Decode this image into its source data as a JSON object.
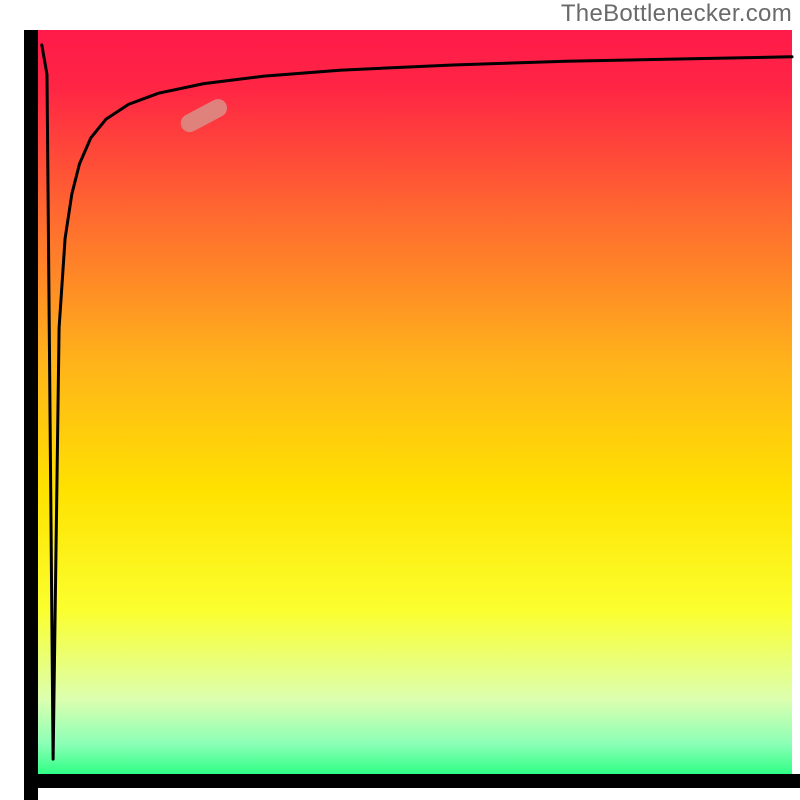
{
  "watermark": "TheBottlenecker.com",
  "chart_data": {
    "type": "line",
    "title": "",
    "xlabel": "",
    "ylabel": "",
    "xlim": [
      0,
      100
    ],
    "ylim": [
      0,
      100
    ],
    "background_gradient": {
      "stops": [
        {
          "offset": 0.0,
          "color": "#ff1a4a"
        },
        {
          "offset": 0.08,
          "color": "#ff2644"
        },
        {
          "offset": 0.25,
          "color": "#ff6a2f"
        },
        {
          "offset": 0.45,
          "color": "#ffb41a"
        },
        {
          "offset": 0.62,
          "color": "#ffe200"
        },
        {
          "offset": 0.78,
          "color": "#fbff2e"
        },
        {
          "offset": 0.9,
          "color": "#dcffb0"
        },
        {
          "offset": 0.96,
          "color": "#8affb6"
        },
        {
          "offset": 1.0,
          "color": "#2fff85"
        }
      ]
    },
    "curve": {
      "description": "Sharp vertical spike downward near left edge, then rapid logarithmic-like rise toward upper right",
      "x": [
        0.5,
        1.2,
        2.0,
        2.8,
        3.6,
        4.5,
        5.5,
        7.0,
        9.0,
        12.0,
        16.0,
        22.0,
        30.0,
        40.0,
        55.0,
        70.0,
        85.0,
        100.0
      ],
      "y": [
        98.0,
        94.0,
        2.0,
        60.0,
        72.0,
        78.0,
        82.0,
        85.5,
        88.0,
        90.0,
        91.5,
        92.8,
        93.8,
        94.6,
        95.3,
        95.8,
        96.1,
        96.4
      ]
    },
    "marker": {
      "shape": "rounded-bar",
      "x": 22.0,
      "y": 88.5,
      "angle_deg": 28,
      "color": "#d98f87",
      "opacity": 0.85,
      "width": 50,
      "height": 18
    },
    "axes": {
      "line_color": "#000000",
      "line_width": 14
    }
  }
}
